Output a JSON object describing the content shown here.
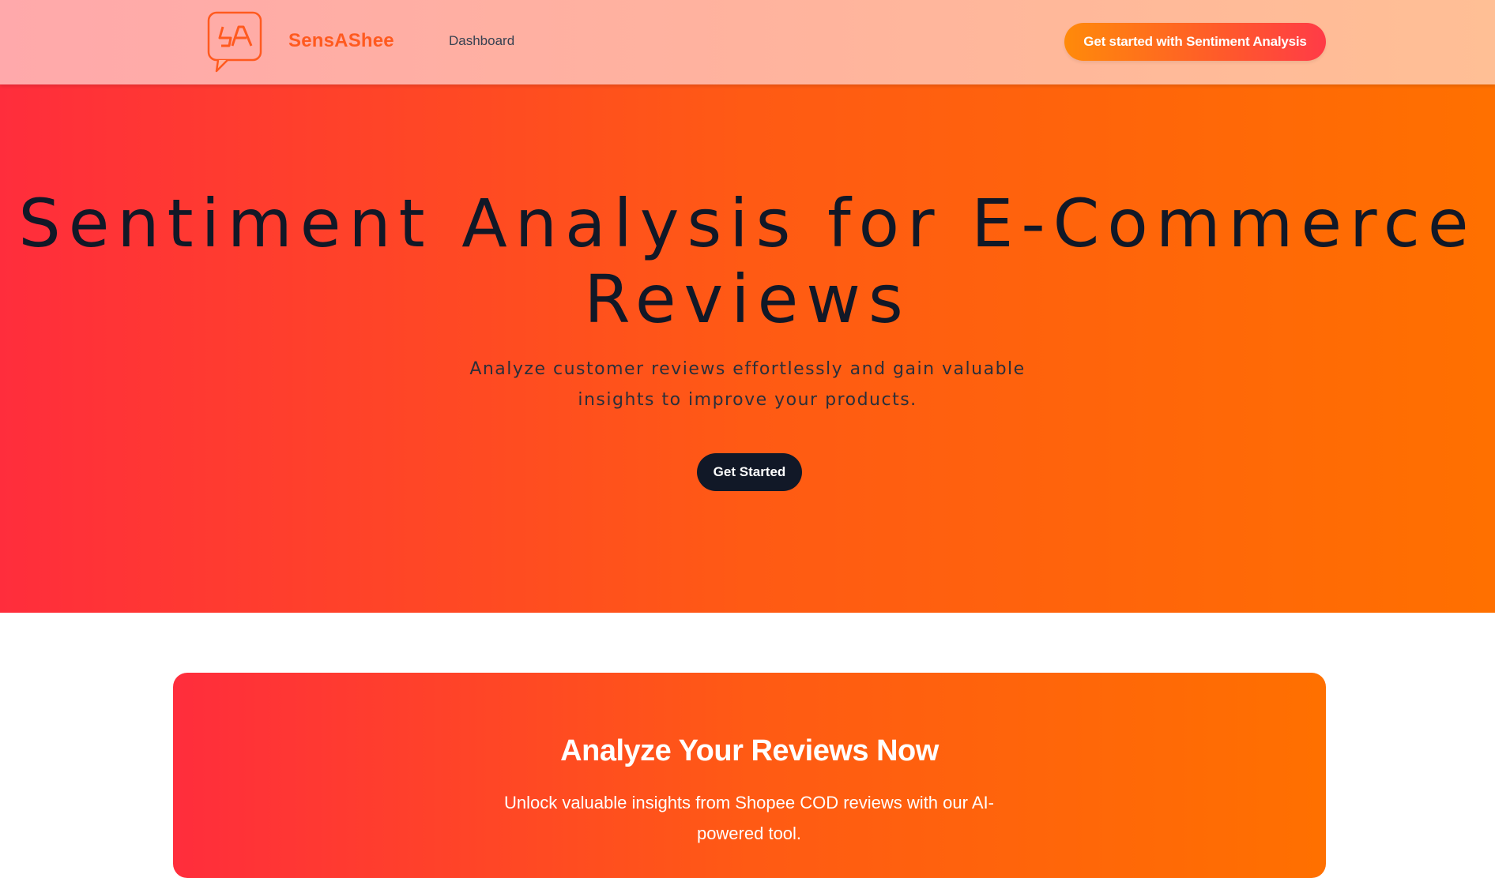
{
  "header": {
    "brand_name": "SensAShee",
    "logo_icon": "speech-bubble-sa-logo-icon",
    "nav_links": [
      {
        "label": "Dashboard"
      }
    ],
    "cta_label": "Get started with Sentiment Analysis"
  },
  "hero": {
    "title": "Sentiment Analysis for E-Commerce Reviews",
    "subtitle": "Analyze customer reviews effortlessly and gain valuable insights to improve your products.",
    "button_label": "Get Started"
  },
  "analyze_section": {
    "title": "Analyze Your Reviews Now",
    "subtitle": "Unlock valuable insights from Shopee COD reviews with our AI-powered tool."
  },
  "colors": {
    "brand_orange": "#ff5a1f",
    "gradient_start": "#ff2d3c",
    "gradient_end": "#ff7000",
    "dark": "#111827"
  }
}
